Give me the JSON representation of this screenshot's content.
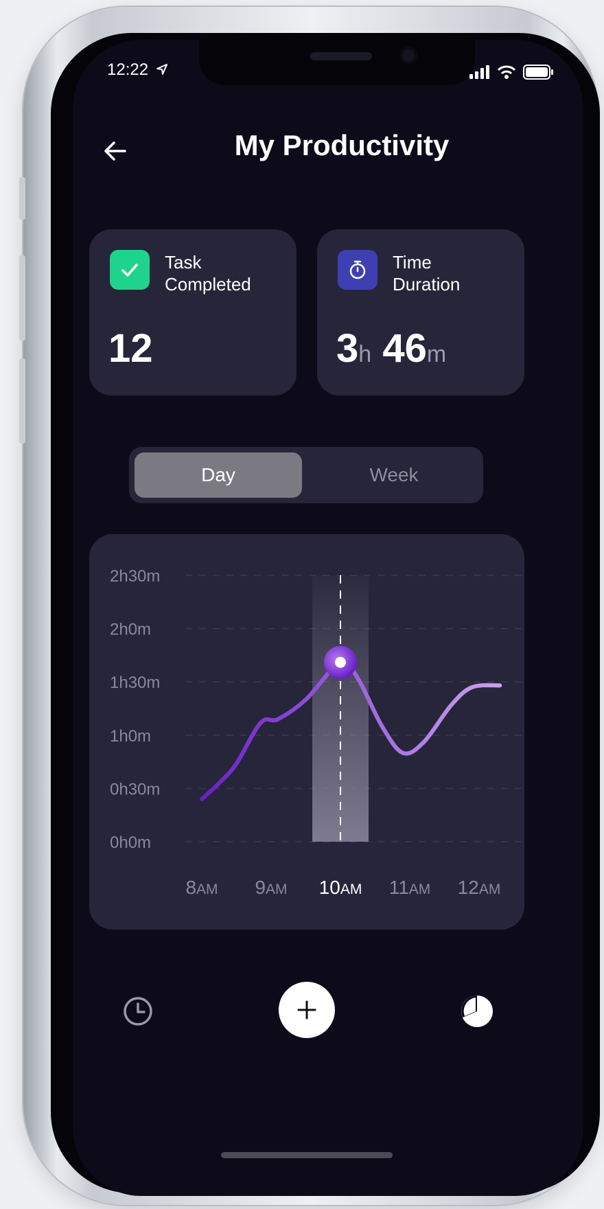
{
  "status_bar": {
    "time": "12:22"
  },
  "header": {
    "title": "My Productivity"
  },
  "cards": {
    "tasks": {
      "label_line1": "Task",
      "label_line2": "Completed",
      "value": "12",
      "icon": "check-icon",
      "color": "#1fd38c"
    },
    "time": {
      "label_line1": "Time",
      "label_line2": "Duration",
      "hours": "3",
      "hours_unit": "h",
      "minutes": "46",
      "minutes_unit": "m",
      "icon": "stopwatch-icon",
      "color": "#3d3fb2"
    }
  },
  "period_toggle": {
    "selected": "Day",
    "options": [
      "Day",
      "Week"
    ]
  },
  "chart_data": {
    "type": "line",
    "x": [
      "8AM",
      "9AM",
      "10AM",
      "11AM",
      "12AM"
    ],
    "x_label_parts": [
      [
        "8",
        "AM"
      ],
      [
        "9",
        "AM"
      ],
      [
        "10",
        "AM"
      ],
      [
        "11",
        "AM"
      ],
      [
        "12",
        "AM"
      ]
    ],
    "y_ticks": [
      "0h0m",
      "0h30m",
      "1h0m",
      "1h30m",
      "2h0m",
      "2h30m"
    ],
    "ylim_minutes": [
      0,
      150
    ],
    "series": [
      {
        "points": [
          {
            "x": 8.0,
            "y": 24
          },
          {
            "x": 8.25,
            "y": 33
          },
          {
            "x": 8.5,
            "y": 44
          },
          {
            "x": 8.85,
            "y": 67
          },
          {
            "x": 9.1,
            "y": 69
          },
          {
            "x": 9.5,
            "y": 80
          },
          {
            "x": 10.0,
            "y": 101
          },
          {
            "x": 10.25,
            "y": 92
          },
          {
            "x": 10.6,
            "y": 65
          },
          {
            "x": 10.9,
            "y": 50
          },
          {
            "x": 11.2,
            "y": 56
          },
          {
            "x": 11.6,
            "y": 77
          },
          {
            "x": 11.9,
            "y": 87
          },
          {
            "x": 12.3,
            "y": 88
          }
        ]
      }
    ],
    "highlight_x": "10AM",
    "highlight_value_minutes": 101,
    "colors": {
      "line_start": "#6a1fc7",
      "line_end": "#c9a3ef",
      "band": "#8e8aa0"
    }
  },
  "bottom_nav": {
    "left_icon": "clock-icon",
    "center_icon": "plus-icon",
    "right_icon": "pie-chart-icon"
  }
}
